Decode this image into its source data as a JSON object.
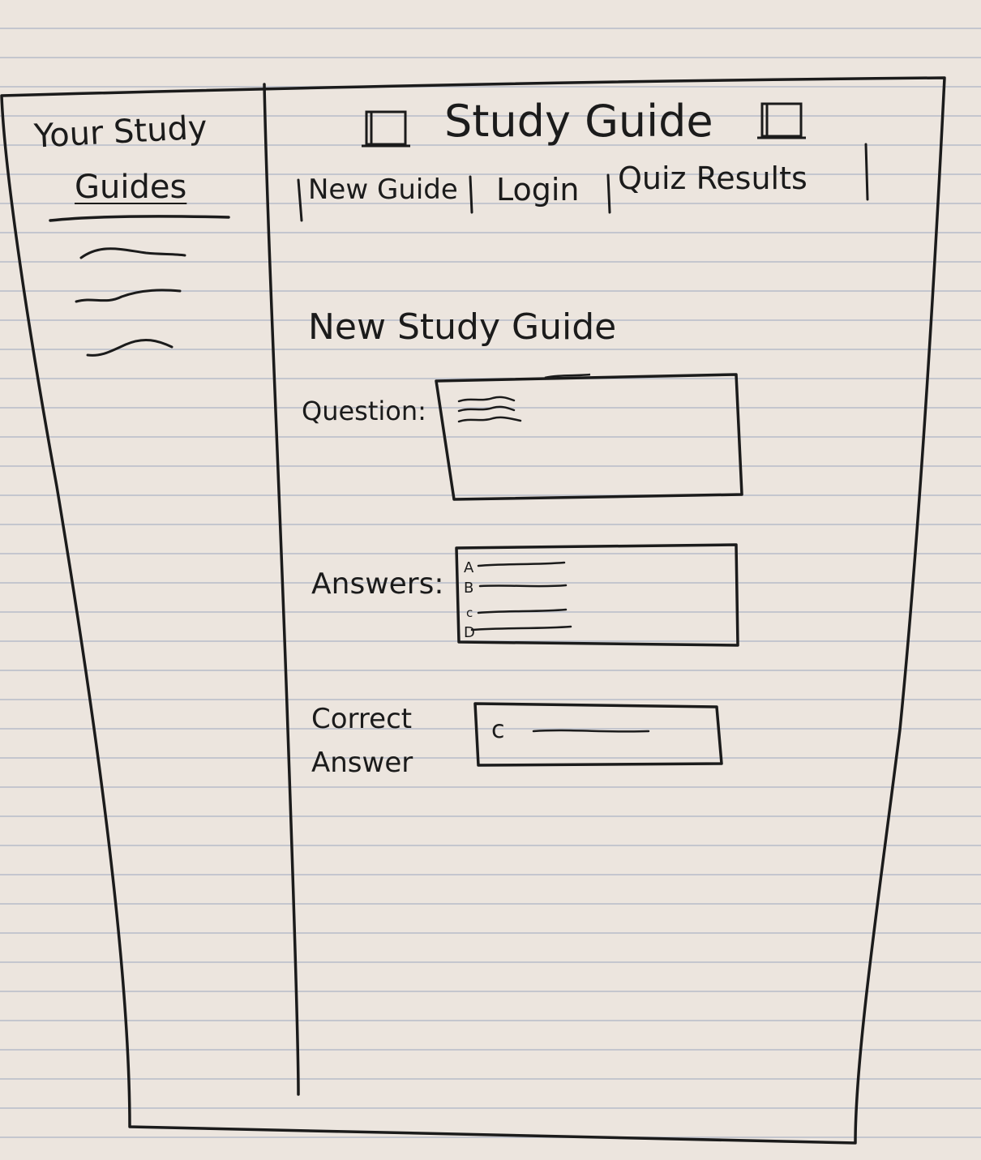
{
  "sidebar": {
    "title_line1": "Your Study",
    "title_line2": "Guides",
    "items": [
      "",
      "",
      ""
    ]
  },
  "header": {
    "title": "Study Guide"
  },
  "nav": {
    "items": [
      {
        "label": "New Guide"
      },
      {
        "label": "Login"
      },
      {
        "label": "Quiz Results"
      }
    ]
  },
  "form": {
    "heading": "New Study Guide",
    "question_label": "Question:",
    "answers_label": "Answers:",
    "answer_options": [
      {
        "letter": "A"
      },
      {
        "letter": "B"
      },
      {
        "letter": "c"
      },
      {
        "letter": "D"
      }
    ],
    "correct_label": "Correct\nAnswer",
    "correct_value": "c"
  },
  "colors": {
    "paper": "#ece5de",
    "rule_lines": "#8a9ab5",
    "ink": "#1b1b1b"
  },
  "icons": [
    "image-placeholder-icon",
    "image-placeholder-icon"
  ]
}
